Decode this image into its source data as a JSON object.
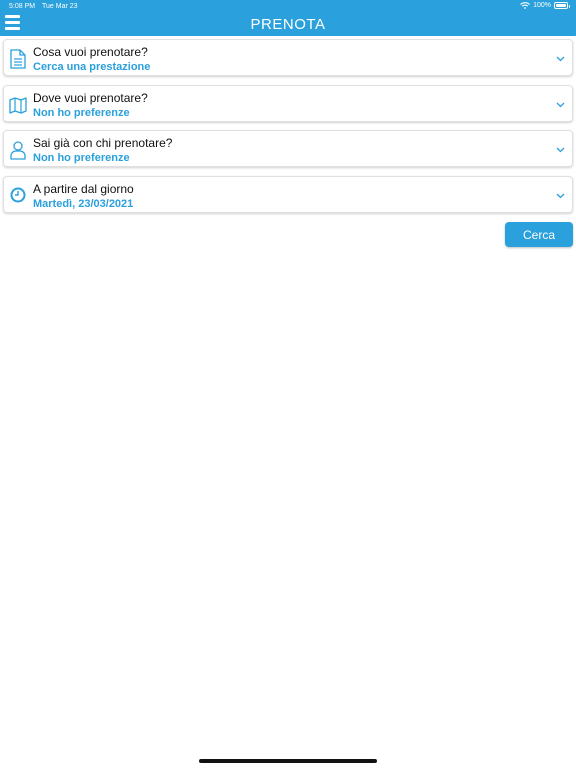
{
  "status_bar": {
    "time": "5:08 PM",
    "date": "Tue Mar 23",
    "battery": "100%"
  },
  "header": {
    "title": "PRENOTA"
  },
  "fields": [
    {
      "label": "Cosa vuoi prenotare?",
      "value": "Cerca una prestazione",
      "icon": "document-icon"
    },
    {
      "label": "Dove vuoi prenotare?",
      "value": "Non ho preferenze",
      "icon": "map-icon"
    },
    {
      "label": "Sai già con chi prenotare?",
      "value": "Non ho preferenze",
      "icon": "user-icon"
    },
    {
      "label": "A partire dal giorno",
      "value": "Martedì, 23/03/2021",
      "icon": "clock-icon"
    }
  ],
  "search_button": {
    "label": "Cerca"
  },
  "colors": {
    "accent": "#2aa0dc",
    "text": "#111111",
    "background": "#ffffff"
  }
}
